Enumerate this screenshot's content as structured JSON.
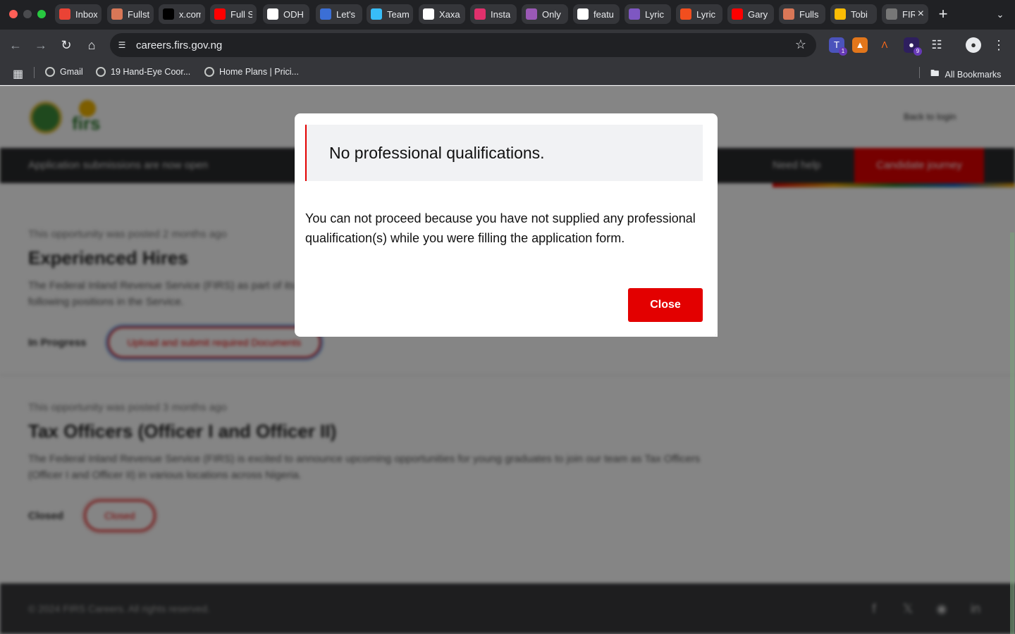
{
  "browser": {
    "tabs": [
      {
        "label": "Inbox",
        "icon": "gmail-icon",
        "color": "#ea4335"
      },
      {
        "label": "Fullstack",
        "icon": "claude-icon",
        "color": "#d97757"
      },
      {
        "label": "x.com",
        "icon": "x-icon",
        "color": "#000000"
      },
      {
        "label": "Full Stack",
        "icon": "youtube-icon",
        "color": "#ff0000"
      },
      {
        "label": "ODH",
        "icon": "openai-icon",
        "color": "#ffffff"
      },
      {
        "label": "Let's",
        "icon": "avatar-icon",
        "color": "#3b6fd6"
      },
      {
        "label": "Team",
        "icon": "tailwind-icon",
        "color": "#38bdf8"
      },
      {
        "label": "Xaxa",
        "icon": "github-icon",
        "color": "#ffffff"
      },
      {
        "label": "Insta",
        "icon": "instagram-icon",
        "color": "#e1306c"
      },
      {
        "label": "Only",
        "icon": "onlyfans-icon",
        "color": "#9b59b6"
      },
      {
        "label": "featu",
        "icon": "github-icon",
        "color": "#ffffff"
      },
      {
        "label": "Lyric",
        "icon": "lyric-icon",
        "color": "#7e57c2"
      },
      {
        "label": "Lyric",
        "icon": "figma-icon",
        "color": "#f24e1e"
      },
      {
        "label": "Gary",
        "icon": "youtube-icon",
        "color": "#ff0000"
      },
      {
        "label": "Fulls",
        "icon": "claude-icon",
        "color": "#d97757"
      },
      {
        "label": "Tobi",
        "icon": "photos-icon",
        "color": "#fbbc04"
      },
      {
        "label": "FIRS",
        "icon": "firs-icon",
        "color": "#777777"
      }
    ],
    "url": "careers.firs.gov.ng",
    "bookmarks": [
      {
        "label": "Gmail"
      },
      {
        "label": "19 Hand-Eye Coor..."
      },
      {
        "label": "Home Plans | Prici..."
      }
    ],
    "all_bookmarks": "All Bookmarks",
    "extension_badge_teams": "1",
    "extension_badge_purple": "9"
  },
  "page": {
    "header": {
      "signin": "Back to login",
      "announcement": "Application submissions are now open",
      "help": "Need help",
      "journey": "Candidate journey"
    },
    "opportunities": [
      {
        "posted": "This opportunity was posted 2 months ago",
        "title": "Experienced Hires",
        "desc": "The Federal Inland Revenue Service (FIRS) as part of its drive to build a formidable workforce is seeking to fill operational positions in the following positions in the Service.",
        "status": "In Progress",
        "action": "Upload and submit required Documents"
      },
      {
        "posted": "This opportunity was posted 3 months ago",
        "title": "Tax Officers (Officer I and Officer II)",
        "desc": "The Federal Inland Revenue Service (FIRS) is excited to announce upcoming opportunities for young graduates to join our team as Tax Officers (Officer I and Officer II) in various locations across Nigeria.",
        "status": "Closed",
        "action": "Closed"
      }
    ],
    "footer": {
      "copyright": "© 2024 FIRS Careers. All rights reserved."
    }
  },
  "modal": {
    "title": "No professional qualifications.",
    "message": "You can not proceed because you have not supplied any professional qualification(s) while you were filling the application form.",
    "close_label": "Close",
    "accent": "#e30000"
  }
}
